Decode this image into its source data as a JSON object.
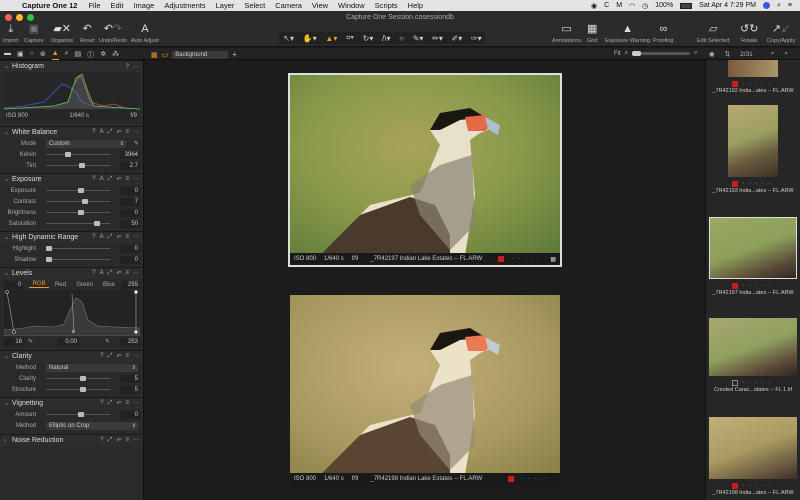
{
  "menubar": {
    "app": "Capture One 12",
    "items": [
      "File",
      "Edit",
      "Image",
      "Adjustments",
      "Layer",
      "Select",
      "Camera",
      "View",
      "Window",
      "Scripts",
      "Help"
    ],
    "battery": "100%",
    "clock": "Sat Apr 4  7:29 PM"
  },
  "window": {
    "title": "Capture One Session.cosessiondb"
  },
  "toolbar": {
    "left": [
      {
        "label": "Import",
        "icon": "download-icon"
      },
      {
        "label": "Capture",
        "icon": "camera-icon"
      },
      {
        "label": "Organize",
        "icon": "folder-icon"
      },
      {
        "label": "Reset",
        "icon": "reset-icon"
      },
      {
        "label": "Undo/Redo",
        "icon": "undo-icon"
      },
      {
        "label": "Auto Adjust",
        "icon": "auto-adjust-icon"
      }
    ],
    "cursor_tools_label": "Cursor Tools",
    "right": [
      {
        "label": "Annotations",
        "icon": "annotations-icon"
      },
      {
        "label": "Grid",
        "icon": "grid-icon"
      },
      {
        "label": "Exposure Warning",
        "icon": "warning-icon"
      },
      {
        "label": "Proofing",
        "icon": "glasses-icon"
      },
      {
        "label": "Edit Selected",
        "icon": "edit-selected-icon"
      },
      {
        "label": "Rotate",
        "icon": "rotate-icon"
      },
      {
        "label": "Copy/Apply",
        "icon": "copy-apply-icon"
      }
    ]
  },
  "viewer_bar": {
    "layer": "Background",
    "fit": "Fit",
    "counter": "2/31"
  },
  "histogram": {
    "title": "Histogram",
    "iso": "ISO 800",
    "shutter": "1/640 s",
    "aperture": "f/9"
  },
  "white_balance": {
    "title": "White Balance",
    "mode_label": "Mode",
    "mode": "Custom",
    "kelvin_label": "Kelvin",
    "kelvin": "3964",
    "kelvin_pos": 0.3,
    "tint_label": "Tint",
    "tint": "2.7",
    "tint_pos": 0.52
  },
  "exposure": {
    "title": "Exposure",
    "rows": [
      {
        "label": "Exposure",
        "value": "0",
        "pos": 0.5
      },
      {
        "label": "Contrast",
        "value": "7",
        "pos": 0.57
      },
      {
        "label": "Brightness",
        "value": "0",
        "pos": 0.5
      },
      {
        "label": "Saturation",
        "value": "50",
        "pos": 0.75
      }
    ]
  },
  "hdr": {
    "title": "High Dynamic Range",
    "rows": [
      {
        "label": "Highlight",
        "value": "0",
        "pos": 0.0
      },
      {
        "label": "Shadow",
        "value": "0",
        "pos": 0.0
      }
    ]
  },
  "levels": {
    "title": "Levels",
    "tabs": [
      "RGB",
      "Red",
      "Green",
      "Blue"
    ],
    "input_low": "0",
    "input_high": "255",
    "output_low": "16",
    "midtone": "0.00",
    "output_high": "253"
  },
  "clarity": {
    "title": "Clarity",
    "method_label": "Method",
    "method": "Natural",
    "rows": [
      {
        "label": "Clarity",
        "value": "5",
        "pos": 0.53
      },
      {
        "label": "Structure",
        "value": "5",
        "pos": 0.53
      }
    ]
  },
  "vignetting": {
    "title": "Vignetting",
    "amount_label": "Amount",
    "amount": "0",
    "amount_pos": 0.5,
    "method_label": "Method",
    "method": "Elliptic on Crop"
  },
  "noise": {
    "title": "Noise Reduction"
  },
  "viewers": [
    {
      "iso": "ISO 800",
      "shutter": "1/640 s",
      "aperture": "f/9",
      "name": "_7R42197 Indian Lake Estates -- FL.ARW"
    },
    {
      "iso": "ISO 800",
      "shutter": "1/640 s",
      "aperture": "f/9",
      "name": "_7R42198 Indian Lake Estates -- FL.ARW"
    }
  ],
  "thumbnails": [
    {
      "name": "_7R42192 India...ates -- FL.ARW",
      "tag": "red"
    },
    {
      "name": "_7R42193 India...ates -- FL.ARW",
      "tag": "red"
    },
    {
      "name": "_7R42197 India...ates -- FL.ARW",
      "tag": "red",
      "selected": true
    },
    {
      "name": "Crested Carac...states -- FL 1.tif",
      "tag": "none"
    },
    {
      "name": "_7R42198 India...ates -- FL.ARW",
      "tag": "red"
    }
  ],
  "colors": {
    "accent": "#f39c1f",
    "tag_red": "#c81e1e"
  }
}
